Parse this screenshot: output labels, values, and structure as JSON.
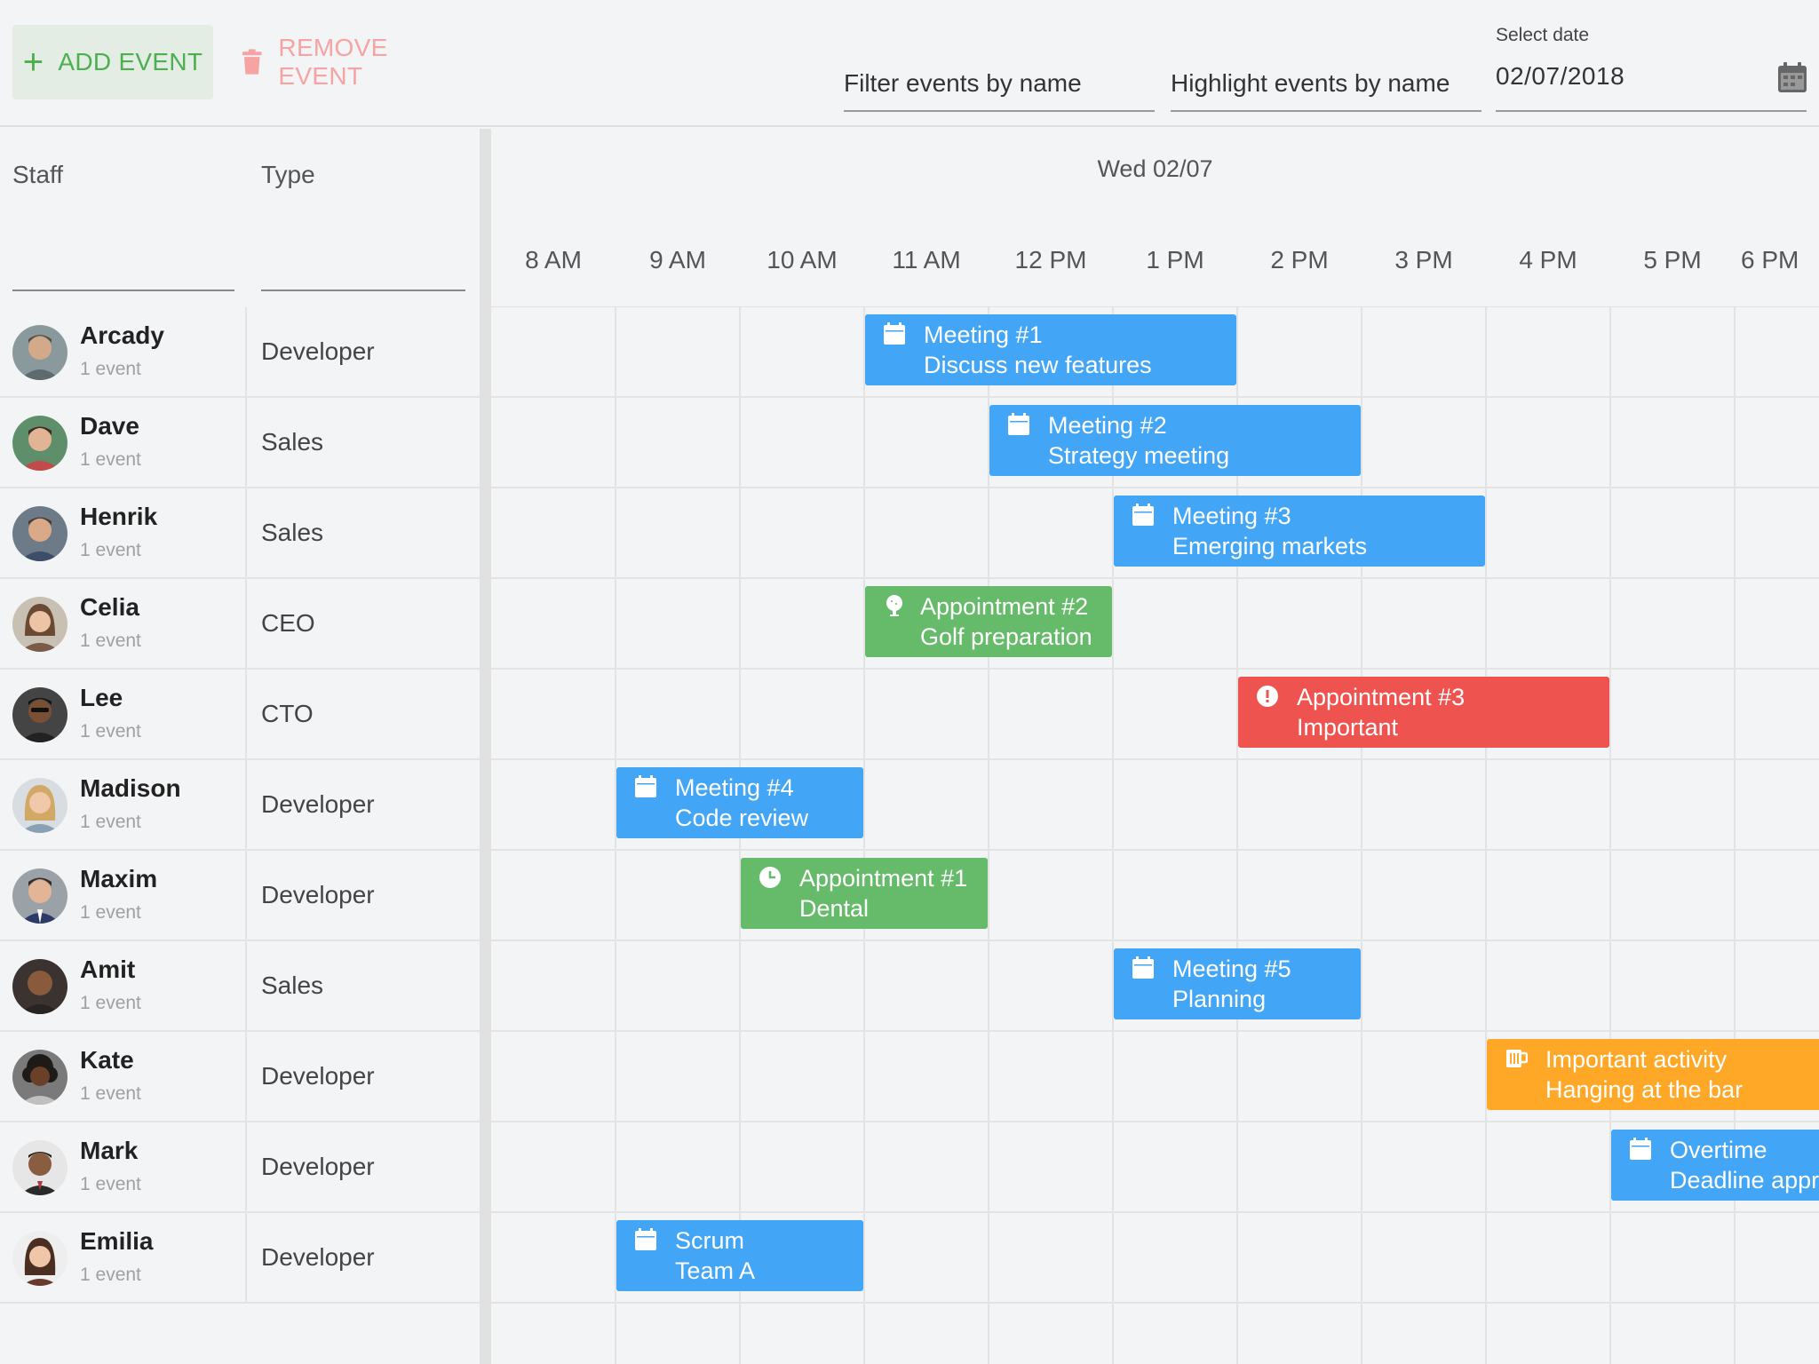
{
  "toolbar": {
    "add_label": "ADD EVENT",
    "remove_label": "REMOVE EVENT",
    "filter_placeholder": "Filter events by name",
    "highlight_placeholder": "Highlight events by name",
    "date_label": "Select date",
    "date_value": "02/07/2018"
  },
  "grid": {
    "columns": {
      "staff": "Staff",
      "type": "Type"
    },
    "day": "Wed 02/07",
    "hours": [
      "8 AM",
      "9 AM",
      "10 AM",
      "11 AM",
      "12 PM",
      "1 PM",
      "2 PM",
      "3 PM",
      "4 PM",
      "5 PM",
      "6 PM"
    ]
  },
  "staff": [
    {
      "name": "Arcady",
      "count": "1 event",
      "type": "Developer"
    },
    {
      "name": "Dave",
      "count": "1 event",
      "type": "Sales"
    },
    {
      "name": "Henrik",
      "count": "1 event",
      "type": "Sales"
    },
    {
      "name": "Celia",
      "count": "1 event",
      "type": "CEO"
    },
    {
      "name": "Lee",
      "count": "1 event",
      "type": "CTO"
    },
    {
      "name": "Madison",
      "count": "1 event",
      "type": "Developer"
    },
    {
      "name": "Maxim",
      "count": "1 event",
      "type": "Developer"
    },
    {
      "name": "Amit",
      "count": "1 event",
      "type": "Sales"
    },
    {
      "name": "Kate",
      "count": "1 event",
      "type": "Developer"
    },
    {
      "name": "Mark",
      "count": "1 event",
      "type": "Developer"
    },
    {
      "name": "Emilia",
      "count": "1 event",
      "type": "Developer"
    }
  ],
  "events": [
    {
      "title": "Meeting #1",
      "subtitle": "Discuss new features",
      "start": "11:00",
      "end": "2:00",
      "color": "#42a5f5",
      "icon": "calendar-icon"
    },
    {
      "title": "Meeting #2",
      "subtitle": "Strategy meeting",
      "start": "12:00",
      "end": "3:00",
      "color": "#42a5f5",
      "icon": "calendar-icon"
    },
    {
      "title": "Meeting #3",
      "subtitle": "Emerging markets",
      "start": "1:00",
      "end": "4:00",
      "color": "#42a5f5",
      "icon": "calendar-icon"
    },
    {
      "title": "Appointment #2",
      "subtitle": "Golf preparation",
      "start": "11:00",
      "end": "1:00",
      "color": "#66bb6a",
      "icon": "golf-icon"
    },
    {
      "title": "Appointment #3",
      "subtitle": "Important",
      "start": "2:00",
      "end": "5:00",
      "color": "#ef5350",
      "icon": "alert-icon"
    },
    {
      "title": "Meeting #4",
      "subtitle": "Code review",
      "start": "9:00",
      "end": "11:00",
      "color": "#42a5f5",
      "icon": "calendar-icon"
    },
    {
      "title": "Appointment #1",
      "subtitle": "Dental",
      "start": "10:00",
      "end": "12:00",
      "color": "#66bb6a",
      "icon": "clock-icon"
    },
    {
      "title": "Meeting #5",
      "subtitle": "Planning",
      "start": "1:00",
      "end": "3:00",
      "color": "#42a5f5",
      "icon": "calendar-icon"
    },
    {
      "title": "Important activity",
      "subtitle": "Hanging at the bar",
      "start": "4:00",
      "end": "7:00",
      "color": "#ffa726",
      "icon": "beer-icon"
    },
    {
      "title": "Overtime",
      "subtitle": "Deadline approaching",
      "start": "5:00",
      "end": "8:00",
      "color": "#42a5f5",
      "icon": "calendar-icon"
    },
    {
      "title": "Scrum",
      "subtitle": "Team A",
      "start": "9:00",
      "end": "11:00",
      "color": "#42a5f5",
      "icon": "calendar-icon"
    }
  ]
}
